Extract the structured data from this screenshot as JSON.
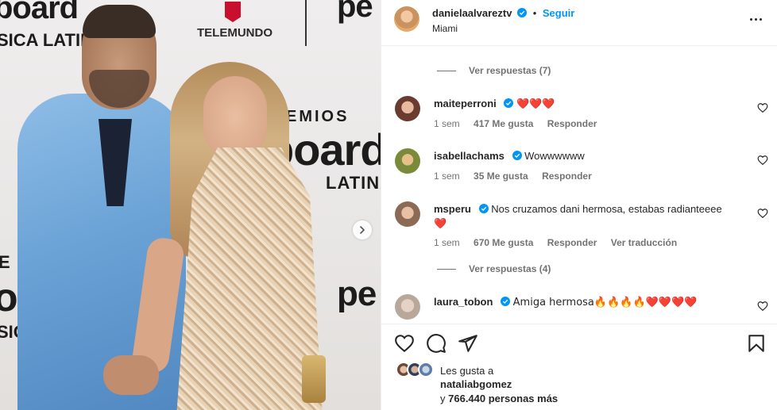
{
  "photo": {
    "backdrop_words": [
      "board",
      "SICA LATINA",
      "TELEMUNDO",
      "pe",
      "EMIOS",
      "board",
      "LATINA",
      "E MI",
      "oard",
      "pe",
      "SICA"
    ]
  },
  "post": {
    "author": "danielaalvareztv",
    "follow_label": "Seguir",
    "location": "Miami",
    "more_icon": "more-options-icon"
  },
  "comments": {
    "replies_1": "Ver respuestas (7)",
    "items": [
      {
        "username": "maiteperroni",
        "verified": true,
        "text": "❤️❤️❤️",
        "time": "1 sem",
        "likes": "417 Me gusta",
        "reply": "Responder",
        "translate": ""
      },
      {
        "username": "isabellachams",
        "verified": true,
        "text": "Wowwwwww",
        "time": "1 sem",
        "likes": "35 Me gusta",
        "reply": "Responder",
        "translate": ""
      },
      {
        "username": "msperu",
        "verified": true,
        "text": "Nos cruzamos dani hermosa, estabas radianteeee",
        "text2": "❤️",
        "time": "1 sem",
        "likes": "670 Me gusta",
        "reply": "Responder",
        "translate": "Ver traducción"
      },
      {
        "username": "laura_tobon",
        "verified": true,
        "text": "Amiga hermosa🔥🔥🔥🔥❤️❤️❤️❤️"
      }
    ],
    "replies_2": "Ver respuestas (4)"
  },
  "likes": {
    "prefix": "Les gusta a",
    "user": "nataliabgomez",
    "connector": "y",
    "count": "766.440 personas más"
  },
  "colors": {
    "accent": "#0095f6",
    "verified": "#0095f6",
    "heart": "#ed4956",
    "muted": "#737373"
  }
}
